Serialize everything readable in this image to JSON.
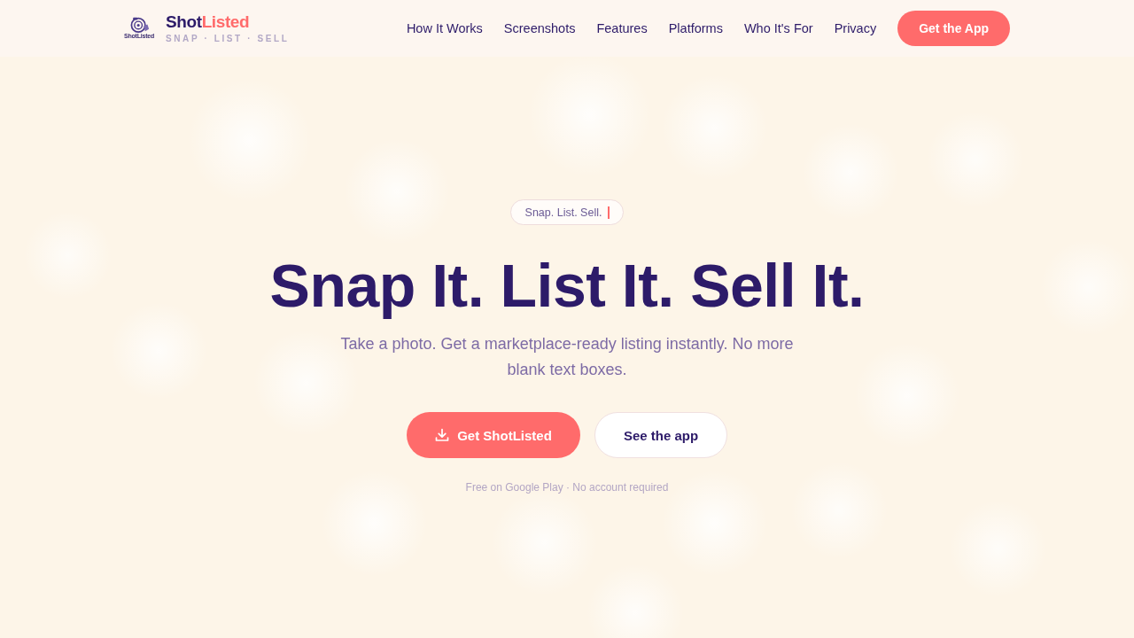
{
  "nav": {
    "logo": {
      "mark_text": "ShotListed",
      "name_parts": [
        {
          "text": "Shot",
          "accent": false
        },
        {
          "text": "Listed",
          "accent": true
        }
      ],
      "tagline": "SNAP · LIST · SELL"
    },
    "links": [
      "How It Works",
      "Screenshots",
      "Features",
      "Platforms",
      "Who It's For",
      "Privacy"
    ],
    "cta": "Get the App"
  },
  "hero": {
    "eyebrow": {
      "text": "Snap. List. Sell.",
      "cursor": true
    },
    "title": "Snap It. List It. Sell It.",
    "subtitle": "Take a photo. Get a marketplace-ready listing instantly. No more blank text boxes.",
    "buttons": [
      {
        "label": "Get ShotListed",
        "kind": "primary"
      },
      {
        "label": "See the app",
        "kind": "secondary"
      }
    ],
    "note": "Free on Google Play · No account required"
  }
}
